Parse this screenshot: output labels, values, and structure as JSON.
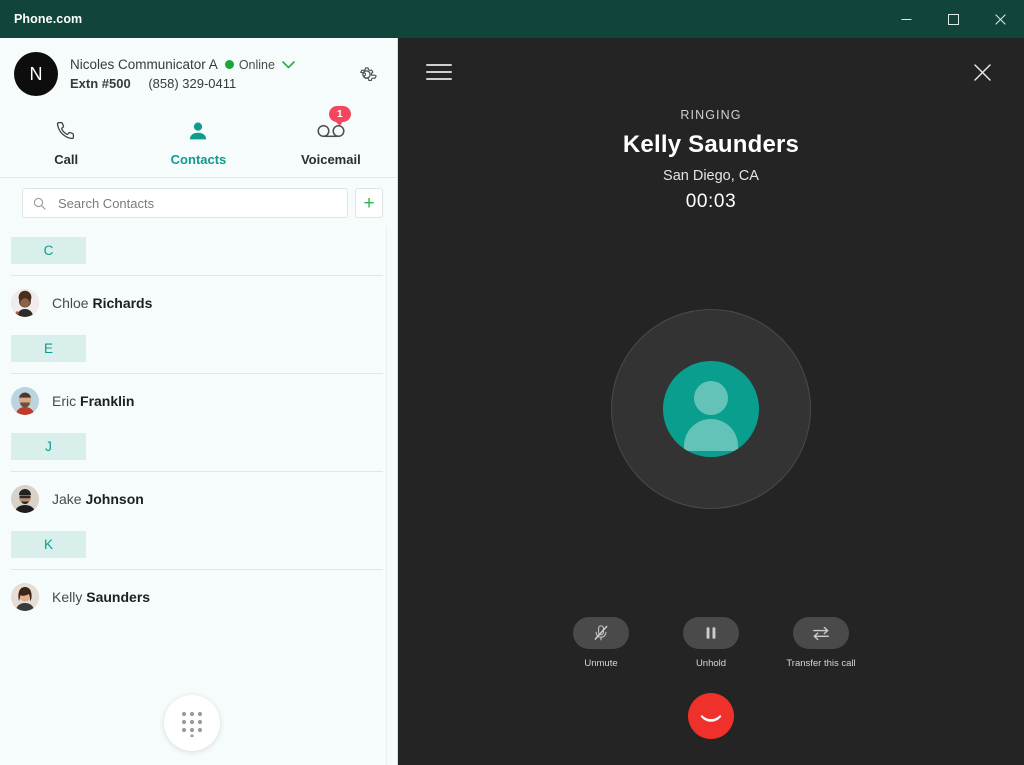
{
  "window": {
    "title": "Phone.com",
    "minimize_label": "Minimize",
    "maximize_label": "Maximize",
    "close_label": "Close",
    "titlebar_color": "#11453c"
  },
  "profile": {
    "avatar_initial": "N",
    "name": "Nicoles Communicator A",
    "status": "Online",
    "status_color": "#19a63a",
    "extension_label": "Extn #500",
    "phone": "(858) 329-0411",
    "settings_label": "Settings"
  },
  "tabs": [
    {
      "label": "Call",
      "icon": "phone-icon",
      "active": false,
      "badge": ""
    },
    {
      "label": "Contacts",
      "icon": "person-icon",
      "active": true,
      "badge": ""
    },
    {
      "label": "Voicemail",
      "icon": "voicemail-icon",
      "active": false,
      "badge": "1"
    }
  ],
  "accent_color": "#0f9b8e",
  "badge_color": "#f4465c",
  "search": {
    "placeholder": "Search Contacts",
    "value": "",
    "add_label": "+"
  },
  "contacts": {
    "sections": [
      {
        "letter": "C",
        "people": [
          {
            "first": "Chloe",
            "last": "Richards"
          }
        ]
      },
      {
        "letter": "E",
        "people": [
          {
            "first": "Eric",
            "last": "Franklin"
          }
        ]
      },
      {
        "letter": "J",
        "people": [
          {
            "first": "Jake",
            "last": "Johnson"
          }
        ]
      },
      {
        "letter": "K",
        "people": [
          {
            "first": "Kelly",
            "last": "Saunders"
          }
        ]
      }
    ]
  },
  "dialpad": {
    "label": "Dialpad"
  },
  "call": {
    "state": "RINGING",
    "name": "Kelly Saunders",
    "location": "San Diego, CA",
    "timer": "00:03",
    "menu_label": "Menu",
    "close_label": "Close call panel",
    "avatar_color": "#0a9e8e",
    "controls": [
      {
        "label": "Unmute",
        "icon": "mic-off-icon"
      },
      {
        "label": "Unhold",
        "icon": "pause-icon"
      },
      {
        "label": "Transfer this call",
        "icon": "transfer-icon"
      }
    ],
    "hangup_label": "End call",
    "hangup_color": "#f0302b"
  }
}
